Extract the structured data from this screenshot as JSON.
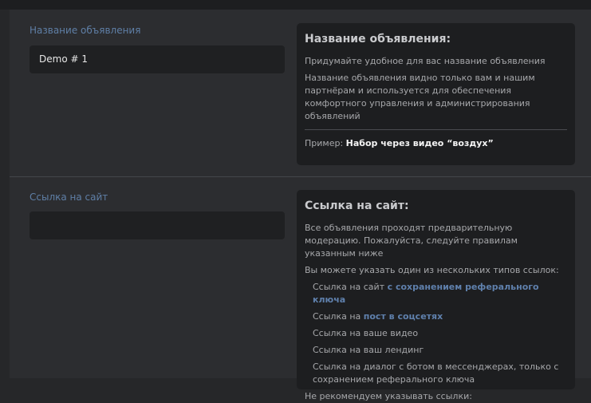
{
  "section1": {
    "label": "Название объявления",
    "input_value": "Demo # 1",
    "help": {
      "title": "Название объявления:",
      "p1": "Придумайте удобное для вас название объявления",
      "p2": "Название объявления видно только вам и нашим партнёрам и используется для обеспечения комфортного управления и администрирования объявлений",
      "example_label": "Пример: ",
      "example_value": "Набор через видео “воздух”"
    }
  },
  "section2": {
    "label": "Ссылка на сайт",
    "input_value": "",
    "help": {
      "title": "Ссылка на сайт:",
      "p1": "Все объявления проходят предварительную модерацию. Пожалуйста, следуйте правилам указанным ниже",
      "p2": "Вы можете указать один из нескольких типов ссылок:",
      "item1_prefix": "Ссылка на сайт ",
      "item1_accent": "с сохранением реферального ключа",
      "item2_prefix": "Ссылка на ",
      "item2_accent": "пост в соцсетях",
      "item3": "Ссылка на ваше видео",
      "item4": "Ссылка на ваш лендинг",
      "item5": "Ссылка на диалог с ботом в мессенджерах, только с сохранением реферального ключа",
      "p3": "Не рекомендуем указывать ссылки:"
    }
  },
  "colors": {
    "background": "#2c2d30",
    "card": "#1d1e20",
    "label": "#5f7fa6",
    "accent": "#5f80ac"
  }
}
